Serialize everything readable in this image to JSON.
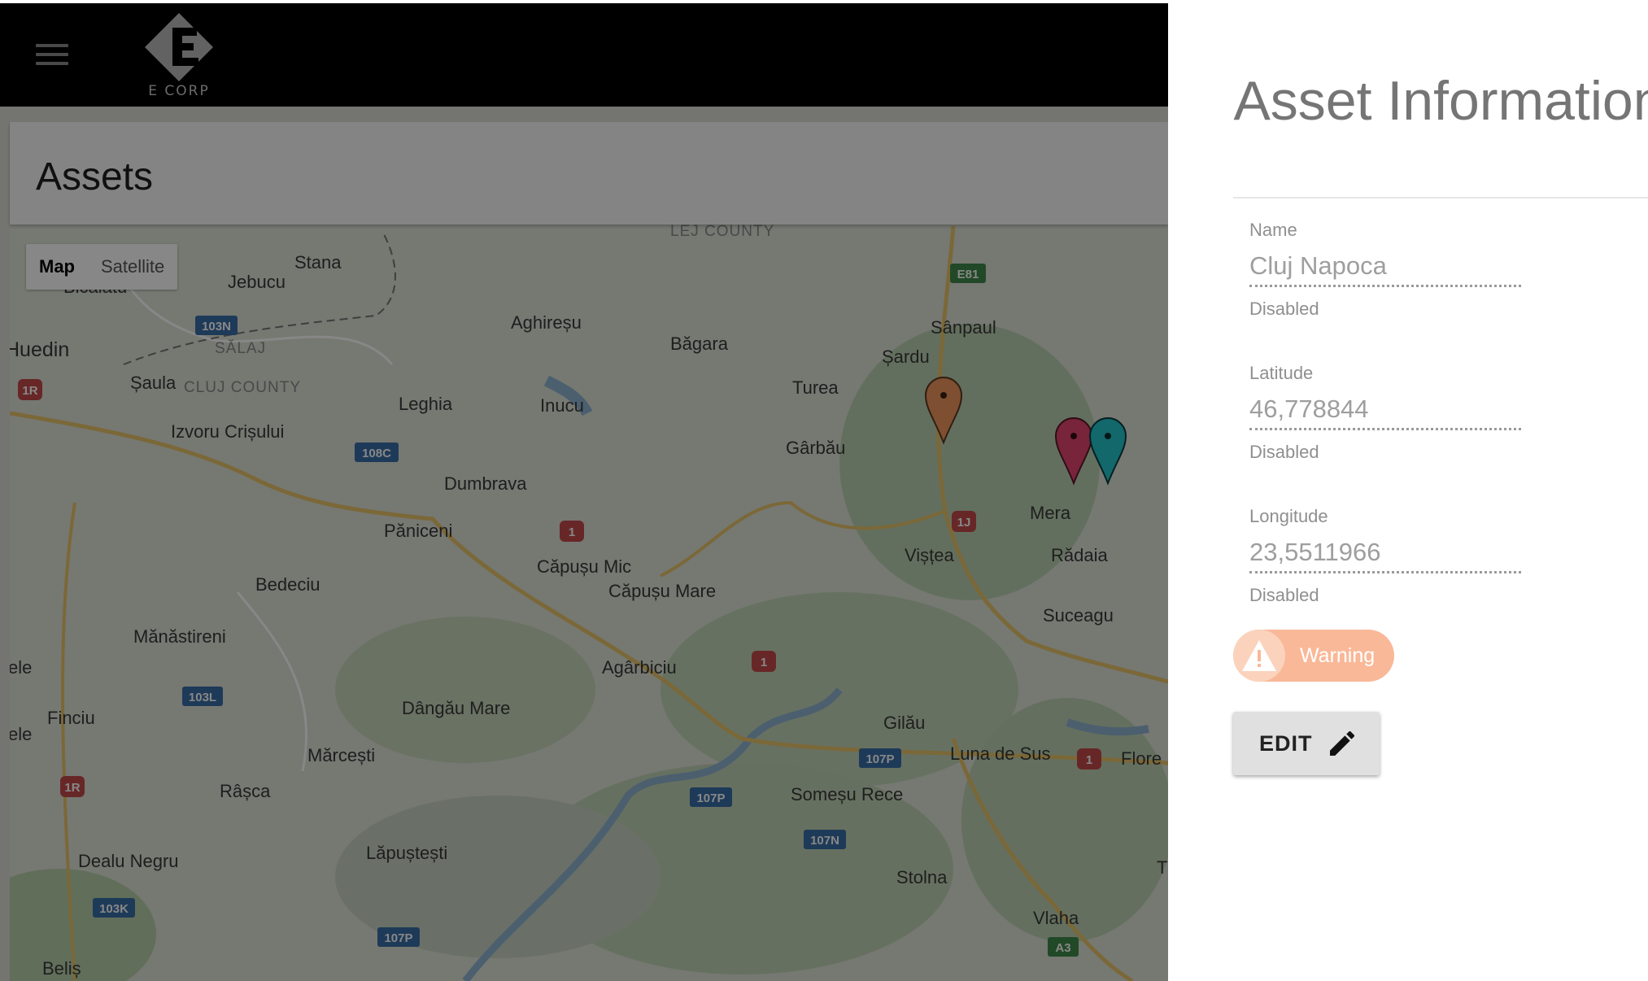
{
  "app": {
    "brand": "E CORP"
  },
  "page": {
    "title": "Assets"
  },
  "map": {
    "toggle": [
      "Map",
      "Satellite"
    ],
    "counties": [
      "SĂLAJ",
      "CLUJ COUNTY",
      "LEJ COUNTY"
    ],
    "places": [
      "Jebucu",
      "Stana",
      "Bicălatu",
      "Huedin",
      "Șaula",
      "Aghireșu",
      "Băgara",
      "Sânpaul",
      "Șardu",
      "Turea",
      "Leghia",
      "Inucu",
      "Izvoru Crișului",
      "Gârbău",
      "Dumbrava",
      "Mera",
      "Rădaia",
      "Vișțea",
      "Păniceni",
      "Căpușu Mic",
      "Căpușu Mare",
      "Bedeciu",
      "Suceagu",
      "Mănăstireni",
      "ele",
      "Agârbiciu",
      "Finciu",
      "Dângău Mare",
      "Gilău",
      "Mărcești",
      "Luna de Sus",
      "Flore",
      "Râșca",
      "Someșu Rece",
      "Dealu Negru",
      "Lăpuștești",
      "Stolna",
      "Vlaha",
      "Beliș",
      "ele",
      "T"
    ],
    "roads": [
      "E81",
      "103N",
      "1R",
      "108C",
      "1",
      "1J",
      "1",
      "103L",
      "1R",
      "107P",
      "107P",
      "1",
      "107N",
      "103K",
      "107P",
      "A3"
    ],
    "markers": [
      "orange",
      "red",
      "teal"
    ]
  },
  "panel": {
    "title": "Asset Information",
    "fields": [
      {
        "label": "Name",
        "value": "Cluj Napoca",
        "helper": "Disabled"
      },
      {
        "label": "Latitude",
        "value": "46,778844",
        "helper": "Disabled"
      },
      {
        "label": "Longitude",
        "value": "23,5511966",
        "helper": "Disabled"
      }
    ],
    "status": {
      "label": "Warning",
      "icon": "warning-icon",
      "color": "#f9b898"
    },
    "edit": {
      "label": "EDIT",
      "icon": "pencil-icon"
    }
  }
}
